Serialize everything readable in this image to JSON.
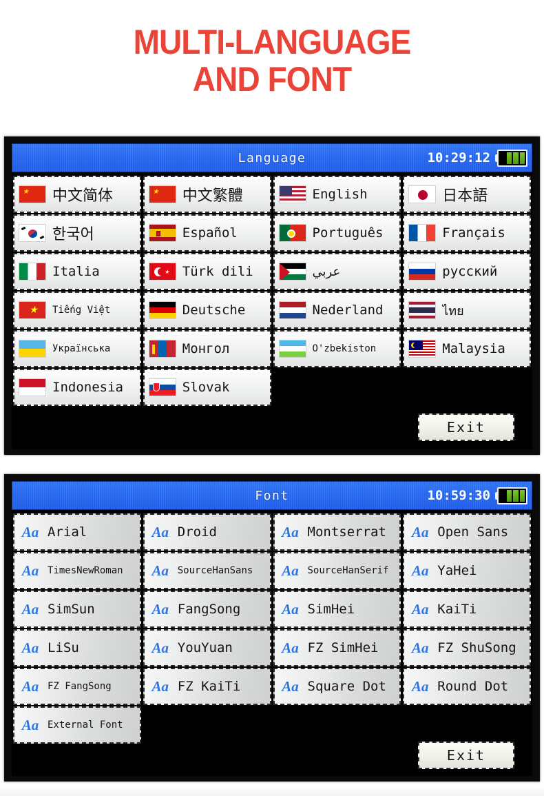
{
  "title": {
    "line1": "MULTI-LANGUAGE",
    "line2": "AND FONT",
    "color": "#ea4337"
  },
  "language_screen": {
    "header": {
      "title": "Language",
      "time": "10:29:12",
      "battery_icon": "battery-icon",
      "battery_bars": 3,
      "bar_color": "#79c82b",
      "bg_color": "#2566ef"
    },
    "items": [
      {
        "label": "中文简体",
        "flag": "cn",
        "style": "cjk"
      },
      {
        "label": "中文繁體",
        "flag": "cn",
        "style": "cjk"
      },
      {
        "label": "English",
        "flag": "us",
        "style": "mono"
      },
      {
        "label": "日本語",
        "flag": "jp",
        "style": "cjk"
      },
      {
        "label": "한국어",
        "flag": "kr",
        "style": "cjk"
      },
      {
        "label": "Español",
        "flag": "es",
        "style": "mono"
      },
      {
        "label": "Português",
        "flag": "pt",
        "style": "mono"
      },
      {
        "label": "Français",
        "flag": "fr",
        "style": "mono"
      },
      {
        "label": "Italia",
        "flag": "it",
        "style": "mono"
      },
      {
        "label": "Türk dili",
        "flag": "tr",
        "style": "mono"
      },
      {
        "label": "عربي",
        "flag": "ae",
        "style": "script"
      },
      {
        "label": "русский",
        "flag": "ru",
        "style": "mono"
      },
      {
        "label": "Tiếng Việt",
        "flag": "vn",
        "style": "small"
      },
      {
        "label": "Deutsche",
        "flag": "de",
        "style": "mono"
      },
      {
        "label": "Nederland",
        "flag": "nl",
        "style": "mono"
      },
      {
        "label": "ไทย",
        "flag": "th",
        "style": "script"
      },
      {
        "label": "Українська",
        "flag": "ua",
        "style": "small"
      },
      {
        "label": "Монгол",
        "flag": "mn",
        "style": "mono"
      },
      {
        "label": "O'zbekiston",
        "flag": "uz",
        "style": "small"
      },
      {
        "label": "Malaysia",
        "flag": "my",
        "style": "mono"
      },
      {
        "label": "Indonesia",
        "flag": "id",
        "style": "mono"
      },
      {
        "label": "Slovak",
        "flag": "sk",
        "style": "mono"
      }
    ],
    "exit_label": "Exit"
  },
  "font_screen": {
    "header": {
      "title": "Font",
      "time": "10:59:30",
      "battery_icon": "battery-icon",
      "battery_bars": 3,
      "bar_color": "#79c82b",
      "bg_color": "#2566ef"
    },
    "icon_label": "Aa",
    "icon_color": "#2f76e0",
    "items": [
      {
        "label": "Arial",
        "style": "mono"
      },
      {
        "label": "Droid",
        "style": "mono"
      },
      {
        "label": "Montserrat",
        "style": "mono"
      },
      {
        "label": "Open Sans",
        "style": "mono"
      },
      {
        "label": "TimesNewRoman",
        "style": "small"
      },
      {
        "label": "SourceHanSans",
        "style": "small"
      },
      {
        "label": "SourceHanSerif",
        "style": "small"
      },
      {
        "label": "YaHei",
        "style": "mono"
      },
      {
        "label": "SimSun",
        "style": "mono"
      },
      {
        "label": "FangSong",
        "style": "mono"
      },
      {
        "label": "SimHei",
        "style": "mono"
      },
      {
        "label": "KaiTi",
        "style": "mono"
      },
      {
        "label": "LiSu",
        "style": "mono"
      },
      {
        "label": "YouYuan",
        "style": "mono"
      },
      {
        "label": "FZ SimHei",
        "style": "mono"
      },
      {
        "label": "FZ ShuSong",
        "style": "mono"
      },
      {
        "label": "FZ FangSong",
        "style": "small"
      },
      {
        "label": "FZ KaiTi",
        "style": "mono"
      },
      {
        "label": "Square Dot",
        "style": "mono"
      },
      {
        "label": "Round Dot",
        "style": "mono"
      },
      {
        "label": "External Font",
        "style": "small"
      }
    ],
    "exit_label": "Exit"
  }
}
